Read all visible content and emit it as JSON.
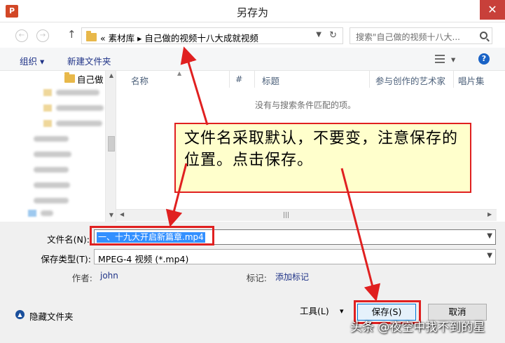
{
  "window": {
    "title": "另存为",
    "app_icon_label": "P",
    "close_glyph": "✕"
  },
  "nav": {
    "back_glyph": "←",
    "forward_glyph": "→",
    "up_glyph": "↑",
    "address": "«  素材库  ▸  自己做的视频十八大成就视频",
    "search_placeholder": "搜索\"自己做的视频十八大..."
  },
  "toolbar": {
    "organize": "组织 ▾",
    "new_folder": "新建文件夹",
    "view_dropdown": "▾",
    "help_glyph": "?"
  },
  "tree": {
    "current_folder": "自己做"
  },
  "file_list": {
    "columns": [
      "名称",
      "#",
      "标题",
      "参与创作的艺术家",
      "唱片集"
    ],
    "empty_message": "没有与搜索条件匹配的项。"
  },
  "form": {
    "filename_label": "文件名(N):",
    "filename_value": "一、十九大开启新篇章.mp4",
    "filetype_label": "保存类型(T):",
    "filetype_value": "MPEG-4 视频 (*.mp4)",
    "author_label": "作者:",
    "author_value": "john",
    "tags_label": "标记:",
    "tags_value": "添加标记"
  },
  "bottom": {
    "hide_folders": "隐藏文件夹",
    "tools": "工具(L)",
    "tools_dd": "▾",
    "save": "保存(S)",
    "cancel": "取消"
  },
  "annotation": {
    "callout_text": "文件名采取默认，不要变，注意保存的位置。点击保存。",
    "highlight_color": "#e02020"
  },
  "watermark": "头条 @夜空中找不到的星"
}
